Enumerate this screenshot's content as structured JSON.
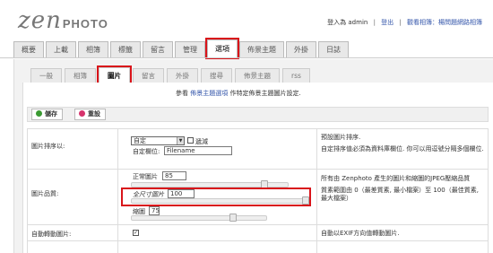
{
  "logo": {
    "zen": "zen",
    "photo": "PHOTO"
  },
  "userbar": {
    "logged_in": "登入為 admin",
    "sep1": "|",
    "logout": "登出",
    "sep2": "|",
    "view_gallery": "觀看相簿：楊問題網路相簿"
  },
  "top_tabs": [
    {
      "label": "概要"
    },
    {
      "label": "上載"
    },
    {
      "label": "相簿"
    },
    {
      "label": "標籤"
    },
    {
      "label": "留言"
    },
    {
      "label": "管理"
    },
    {
      "label": "選項",
      "active": true
    },
    {
      "label": "佈景主題"
    },
    {
      "label": "外掛"
    },
    {
      "label": "日誌"
    }
  ],
  "sub_tabs": [
    {
      "label": "一般"
    },
    {
      "label": "相簿"
    },
    {
      "label": "圖片",
      "active": true
    },
    {
      "label": "留言"
    },
    {
      "label": "外掛"
    },
    {
      "label": "搜尋"
    },
    {
      "label": "佈景主題"
    },
    {
      "label": "rss"
    }
  ],
  "notice": {
    "prefix": "參看",
    "link": "佈景主題選項",
    "suffix": "作特定佈景主題圖片設定."
  },
  "buttons": {
    "save": "儲存",
    "reset": "重設"
  },
  "sort": {
    "label": "圖片排序以:",
    "select_value": "自定",
    "descending_label": "遞減",
    "custom_field_label": "自定欄位:",
    "custom_field_value": "Filename",
    "desc1": "預設圖片排序.",
    "desc2": "自定排序值必須為資料庫欄位. 你可以用逗號分隔多個欄位."
  },
  "quality": {
    "label": "圖片品質:",
    "normal_label": "正常圖片",
    "normal_value": "85",
    "normal_level": 0.85,
    "full_label": "全尺寸圖片",
    "full_value": "100",
    "full_level": 1.0,
    "thumb_label": "縮圖",
    "thumb_value": "75",
    "thumb_level": 0.75,
    "desc1": "所有由 Zenphoto 產生的圖片和縮圖的JPEG壓縮品質",
    "desc2": "質素範圍由 0（最差質素, 最小檔案）至 100（最佳質素, 最大檔案）"
  },
  "autorotate": {
    "label": "自動轉動圖片:",
    "checked": "✓",
    "desc": "自動以EXIF方向值轉動圖片."
  }
}
